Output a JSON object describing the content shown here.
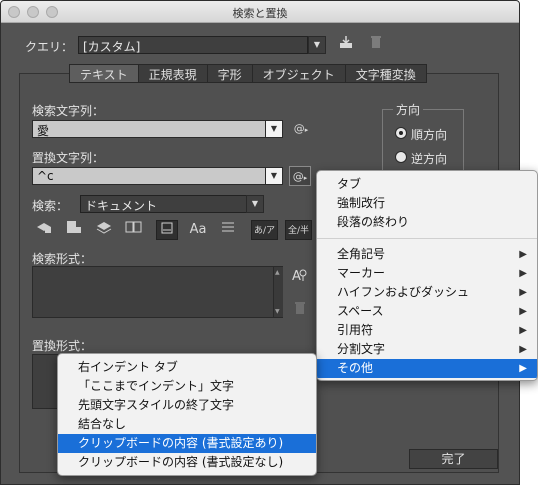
{
  "window": {
    "title": "検索と置換"
  },
  "query": {
    "label": "クエリ：",
    "value": "[カスタム]"
  },
  "tabs": [
    "テキスト",
    "正規表現",
    "字形",
    "オブジェクト",
    "文字種変換"
  ],
  "find": {
    "label": "検索文字列：",
    "value": "愛"
  },
  "replace": {
    "label": "置換文字列：",
    "value": "^c"
  },
  "direction": {
    "title": "方向",
    "forward": "順方向",
    "backward": "逆方向"
  },
  "search": {
    "label": "検索：",
    "value": "ドキュメント"
  },
  "options": {
    "aa": "Aa",
    "kana": "あ/ア",
    "width": "全/半"
  },
  "find_format": {
    "label": "検索形式："
  },
  "replace_format": {
    "label": "置換形式："
  },
  "buttons": {
    "done": "完了"
  },
  "special_menu": {
    "items": [
      "タブ",
      "強制改行",
      "段落の終わり"
    ],
    "submenus": [
      "全角記号",
      "マーカー",
      "ハイフンおよびダッシュ",
      "スペース",
      "引用符",
      "分割文字",
      "その他"
    ],
    "arrow": "▶"
  },
  "other_menu": {
    "items": [
      "右インデント タブ",
      "「ここまでインデント」文字",
      "先頭文字スタイルの終了文字",
      "結合なし",
      "クリップボードの内容 (書式設定あり)",
      "クリップボードの内容 (書式設定なし)"
    ]
  },
  "colors": {
    "dialog_bg": "#535353",
    "menu_bg": "#f2f2f2",
    "menu_highlight": "#1a6fd8"
  }
}
